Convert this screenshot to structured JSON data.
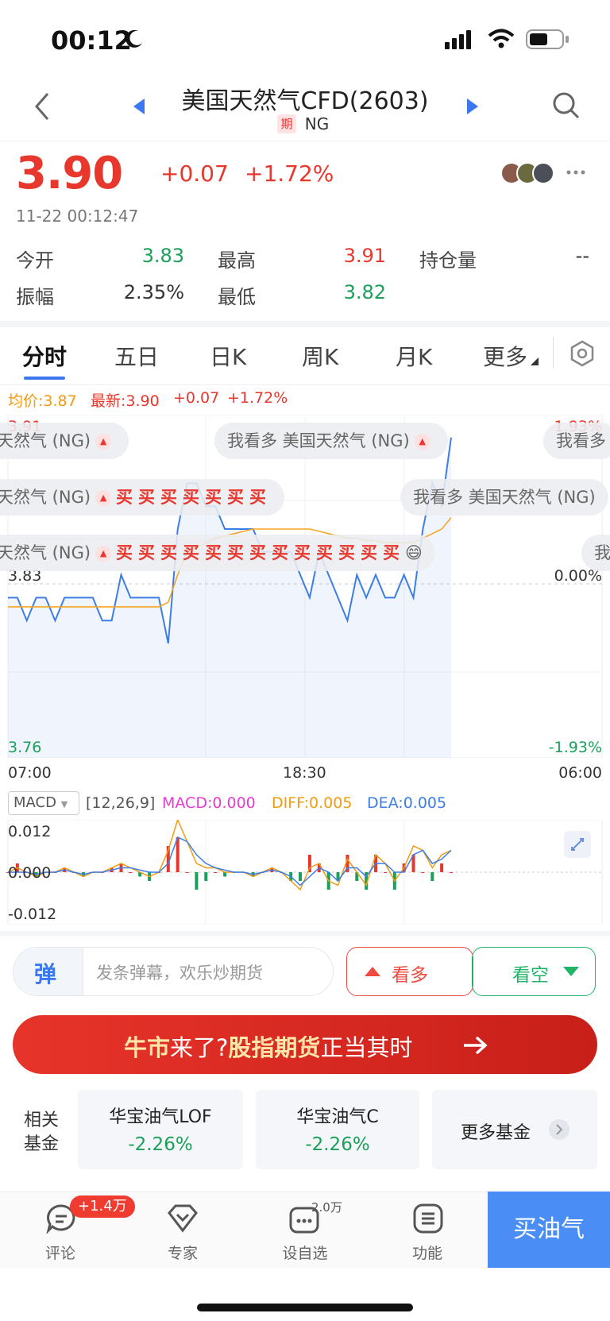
{
  "status_bar": {
    "time": "00:12"
  },
  "header": {
    "title": "美国天然气CFD(2603)",
    "tag": "期",
    "code": "NG"
  },
  "quote": {
    "price": "3.90",
    "change": "+0.07",
    "change_pct": "+1.72%",
    "timestamp": "11-22 00:12:47",
    "stats": [
      {
        "label": "今开",
        "value": "3.83",
        "color": "#1aa05a"
      },
      {
        "label": "最高",
        "value": "3.91",
        "color": "#e8372c"
      },
      {
        "label": "持仓量",
        "value": "--",
        "color": "#333"
      },
      {
        "label": "振幅",
        "value": "2.35%",
        "color": "#333"
      },
      {
        "label": "最低",
        "value": "3.82",
        "color": "#1aa05a"
      }
    ]
  },
  "tabs": [
    "分时",
    "五日",
    "日K",
    "周K",
    "月K",
    "更多"
  ],
  "chart_info": {
    "avg": "均价:3.87",
    "latest": "最新:3.90",
    "change": "+0.07",
    "change_pct": "+1.72%"
  },
  "chart_data": {
    "type": "line",
    "y_labels_left": [
      "3.91",
      "3.83",
      "3.76"
    ],
    "y_labels_right": [
      "1.93%",
      "0.00%",
      "-1.93%"
    ],
    "x_labels": [
      "07:00",
      "18:30",
      "06:00"
    ],
    "ylim": [
      3.76,
      3.91
    ],
    "series": [
      {
        "name": "最新",
        "values": [
          3.83,
          3.83,
          3.82,
          3.83,
          3.83,
          3.82,
          3.83,
          3.83,
          3.83,
          3.83,
          3.82,
          3.82,
          3.84,
          3.83,
          3.83,
          3.83,
          3.83,
          3.81,
          3.86,
          3.88,
          3.88,
          3.87,
          3.87,
          3.86,
          3.86,
          3.86,
          3.86,
          3.85,
          3.85,
          3.85,
          3.85,
          3.84,
          3.83,
          3.85,
          3.84,
          3.83,
          3.82,
          3.84,
          3.83,
          3.84,
          3.83,
          3.83,
          3.84,
          3.83,
          3.86,
          3.88,
          3.87,
          3.9
        ]
      },
      {
        "name": "均价",
        "values": [
          3.826,
          3.826,
          3.826,
          3.826,
          3.826,
          3.826,
          3.826,
          3.826,
          3.826,
          3.826,
          3.826,
          3.826,
          3.826,
          3.826,
          3.826,
          3.826,
          3.826,
          3.828,
          3.84,
          3.85,
          3.852,
          3.854,
          3.856,
          3.857,
          3.858,
          3.859,
          3.86,
          3.86,
          3.86,
          3.86,
          3.86,
          3.86,
          3.86,
          3.859,
          3.858,
          3.857,
          3.856,
          3.856,
          3.855,
          3.855,
          3.854,
          3.854,
          3.854,
          3.854,
          3.856,
          3.858,
          3.86,
          3.865
        ]
      }
    ]
  },
  "macd": {
    "menu": "MACD",
    "params": "[12,26,9]",
    "macd": "MACD:0.000",
    "diff": "DIFF:0.005",
    "dea": "DEA:0.005",
    "y_labels": [
      "0.012",
      "0.000",
      "-0.012"
    ],
    "ylim": [
      -0.012,
      0.012
    ],
    "diff_values": [
      0,
      0.001,
      0,
      -0.001,
      0,
      0,
      0.001,
      0,
      -0.001,
      0,
      0,
      0.001,
      0.002,
      0.001,
      0,
      -0.001,
      0,
      0.005,
      0.012,
      0.007,
      0.002,
      0.001,
      0.001,
      0,
      0,
      0,
      -0.001,
      0,
      0.001,
      0,
      -0.002,
      -0.004,
      0.001,
      0.002,
      -0.002,
      -0.003,
      0.003,
      0,
      -0.003,
      0.004,
      0.002,
      -0.002,
      0.001,
      0.006,
      0.005,
      0.001,
      0.004,
      0.005
    ],
    "dea_values": [
      0,
      0,
      0,
      -0.0005,
      0,
      0,
      0.0005,
      0,
      -0.0005,
      0,
      0,
      0.0005,
      0.001,
      0.001,
      0.0005,
      0,
      0,
      0.002,
      0.008,
      0.007,
      0.004,
      0.002,
      0.001,
      0.0005,
      0,
      0,
      -0.0005,
      0,
      0.0005,
      0,
      -0.001,
      -0.003,
      -0.001,
      0.001,
      0,
      -0.002,
      0.001,
      0.001,
      -0.001,
      0.002,
      0.002,
      0,
      0,
      0.004,
      0.005,
      0.002,
      0.003,
      0.005
    ]
  },
  "danmaku": [
    {
      "text": "天然气 (NG)",
      "buys": "",
      "emoji": ""
    },
    {
      "text": "我看多 美国天然气 (NG)",
      "buys": "",
      "emoji": ""
    },
    {
      "text": "我看多",
      "buys": "",
      "emoji": ""
    },
    {
      "text": "天然气 (NG)",
      "buys": "买买买买买买买",
      "emoji": ""
    },
    {
      "text": "我看多 美国天然气 (NG)",
      "buys": "",
      "emoji": ""
    },
    {
      "text": "天然气 (NG)",
      "buys": "买买买买买买买买买买买买买",
      "emoji": "😄"
    },
    {
      "text": "我",
      "buys": "",
      "emoji": ""
    }
  ],
  "actions": {
    "input_placeholder": "发条弹幕，欢乐炒期货",
    "danmu_icon": "弹",
    "bull": "看多",
    "bear": "看空"
  },
  "banner": {
    "part1": "牛市",
    "part2": "来了?",
    "part3": "股指期货",
    "part4": "正当其时"
  },
  "funds": {
    "section_label_1": "相关",
    "section_label_2": "基金",
    "items": [
      {
        "name": "华宝油气LOF",
        "pct": "-2.26%"
      },
      {
        "name": "华宝油气C",
        "pct": "-2.26%"
      }
    ],
    "more": "更多基金"
  },
  "bottom_nav": [
    {
      "label": "评论",
      "badge": "+1.4万"
    },
    {
      "label": "专家",
      "badge": ""
    },
    {
      "label": "设自选",
      "badge": "2.0万"
    },
    {
      "label": "功能",
      "badge": ""
    }
  ],
  "buy_button": "买油气",
  "colors": {
    "up": "#e8372c",
    "down": "#1aa05a",
    "accent": "#3b78f0",
    "price_line": "#3d7de8",
    "avg_line": "#f5a623"
  }
}
